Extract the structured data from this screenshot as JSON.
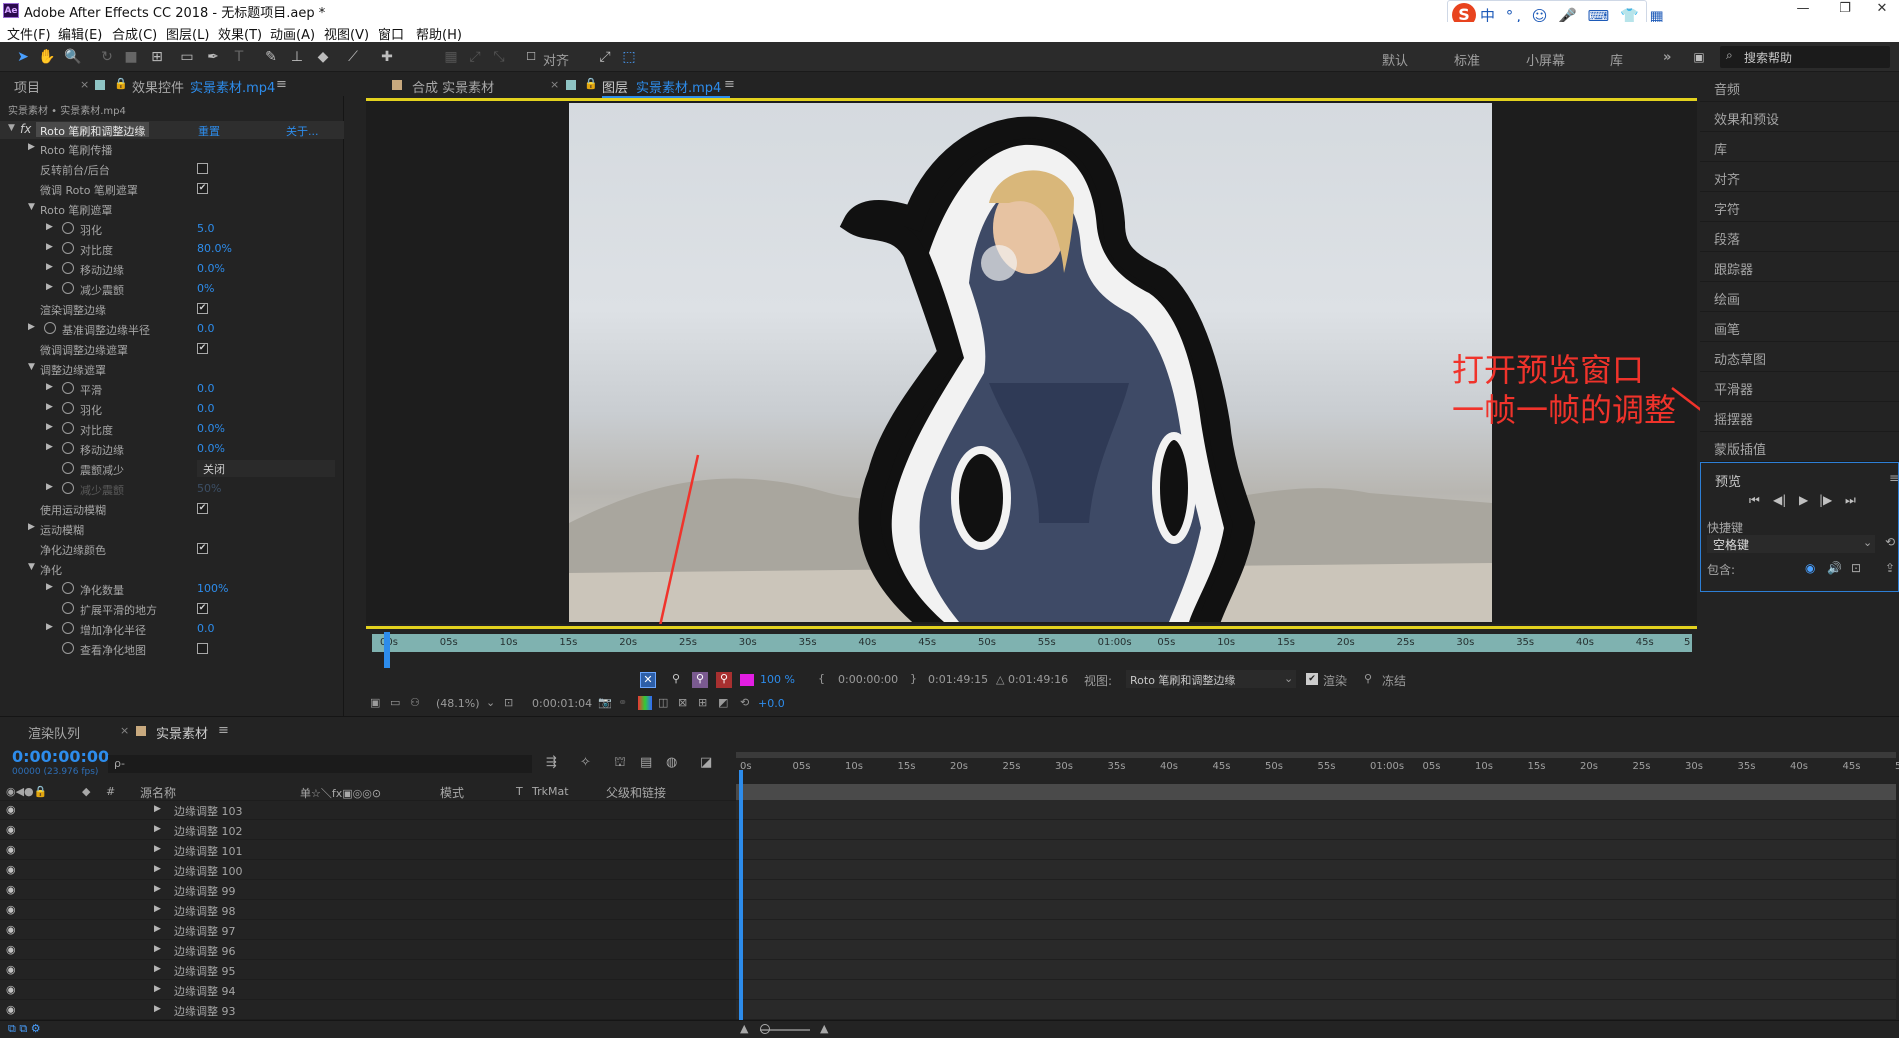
{
  "window": {
    "title": "Adobe After Effects CC 2018 - 无标题项目.aep *",
    "app_icon": "Ae",
    "controls": [
      "—",
      "❐",
      "✕"
    ]
  },
  "menu": [
    "文件(F)",
    "编辑(E)",
    "合成(C)",
    "图层(L)",
    "效果(T)",
    "动画(A)",
    "视图(V)",
    "窗口",
    "帮助(H)"
  ],
  "ime": {
    "logo": "S",
    "text": "中 °, ☺ 🎤 ⌨ 👕 ▦"
  },
  "toolbar": {
    "align_label": "对齐",
    "workspaces": [
      "默认",
      "标准",
      "小屏幕",
      "库"
    ],
    "overflow": "»",
    "search_placeholder": "搜索帮助"
  },
  "left_panel": {
    "tab_project": "项目",
    "tab_effects_prefix": "效果控件",
    "tab_effects_file": "实景素材.mp4",
    "menu_icon": "≡",
    "breadcrumb": "实景素材 • 实景素材.mp4",
    "effect_name": "Roto 笔刷和调整边缘",
    "reset": "重置",
    "about": "关于...",
    "fx": "fx",
    "props": [
      {
        "label": "Roto 笔刷传播",
        "indent": 1,
        "tri": "▶"
      },
      {
        "label": "反转前台/后台",
        "indent": 1,
        "check": ""
      },
      {
        "label": "微调 Roto 笔刷遮罩",
        "indent": 1,
        "check": "✔"
      },
      {
        "label": "Roto 笔刷遮罩",
        "indent": 1,
        "tri": "▼"
      },
      {
        "label": "羽化",
        "indent": 2,
        "tri": "▶",
        "sw": true,
        "value": "5.0"
      },
      {
        "label": "对比度",
        "indent": 2,
        "tri": "▶",
        "sw": true,
        "value": "80.0%"
      },
      {
        "label": "移动边缘",
        "indent": 2,
        "tri": "▶",
        "sw": true,
        "value": "0.0%"
      },
      {
        "label": "减少震颤",
        "indent": 2,
        "tri": "▶",
        "sw": true,
        "value": "0%"
      },
      {
        "label": "渲染调整边缘",
        "indent": 1,
        "check": "✔"
      },
      {
        "label": "基准调整边缘半径",
        "indent": 1,
        "tri": "▶",
        "sw": true,
        "value": "0.0"
      },
      {
        "label": "微调调整边缘遮罩",
        "indent": 1,
        "check": "✔"
      },
      {
        "label": "调整边缘遮罩",
        "indent": 1,
        "tri": "▼"
      },
      {
        "label": "平滑",
        "indent": 2,
        "tri": "▶",
        "sw": true,
        "value": "0.0"
      },
      {
        "label": "羽化",
        "indent": 2,
        "tri": "▶",
        "sw": true,
        "value": "0.0"
      },
      {
        "label": "对比度",
        "indent": 2,
        "tri": "▶",
        "sw": true,
        "value": "0.0%"
      },
      {
        "label": "移动边缘",
        "indent": 2,
        "tri": "▶",
        "sw": true,
        "value": "0.0%"
      },
      {
        "label": "震颤减少",
        "indent": 2,
        "sw": true,
        "select": "关闭"
      },
      {
        "label": "减少震颤",
        "indent": 2,
        "tri": "▶",
        "sw": true,
        "value": "50%",
        "dim": true
      },
      {
        "label": "使用运动模糊",
        "indent": 1,
        "check": "✔"
      },
      {
        "label": "运动模糊",
        "indent": 1,
        "tri": "▶"
      },
      {
        "label": "净化边缘颜色",
        "indent": 1,
        "check": "✔"
      },
      {
        "label": "净化",
        "indent": 1,
        "tri": "▼"
      },
      {
        "label": "净化数量",
        "indent": 2,
        "tri": "▶",
        "sw": true,
        "value": "100%"
      },
      {
        "label": "扩展平滑的地方",
        "indent": 2,
        "sw": true,
        "check": "✔"
      },
      {
        "label": "增加净化半径",
        "indent": 2,
        "tri": "▶",
        "sw": true,
        "value": "0.0"
      },
      {
        "label": "查看净化地图",
        "indent": 2,
        "sw": true,
        "check": ""
      }
    ]
  },
  "comp_panel": {
    "tab_comp": "合成 实景素材",
    "tab_layer_prefix": "图层",
    "tab_layer_file": "实景素材.mp4",
    "ruler": [
      "00s",
      "05s",
      "10s",
      "15s",
      "20s",
      "25s",
      "30s",
      "35s",
      "40s",
      "45s",
      "50s",
      "55s",
      "01:00s",
      "05s",
      "10s",
      "15s",
      "20s",
      "25s",
      "30s",
      "35s",
      "40s",
      "45s"
    ],
    "ruler_end": "5",
    "opacity": "100 %",
    "in_time": "0:00:00:00",
    "out_time": "0:01:49:15",
    "duration": "△ 0:01:49:16",
    "view_label": "视图:",
    "view_value": "Roto 笔刷和调整边缘",
    "render_label": "渲染",
    "freeze_label": "冻结",
    "zoom": "(48.1%)",
    "timecode": "0:00:01:04",
    "exposure": "+0.0"
  },
  "annotation": {
    "line1": "打开预览窗口",
    "line2": "一帧一帧的调整",
    "color": "#f0332b"
  },
  "right_panel": {
    "items": [
      "音频",
      "效果和预设",
      "库",
      "对齐",
      "字符",
      "段落",
      "跟踪器",
      "绘画",
      "画笔",
      "动态草图",
      "平滑器",
      "摇摆器",
      "蒙版插值"
    ],
    "preview": {
      "title": "预览",
      "menu": "≡",
      "shortcut_label": "快捷键",
      "shortcut_value": "空格键",
      "include_label": "包含:"
    }
  },
  "timeline": {
    "tab_render": "渲染队列",
    "tab_comp": "实景素材",
    "timecode": "0:00:00:00",
    "timecode_sub": "00000 (23.976 fps)",
    "search_placeholder": "ρ-",
    "col_num": "#",
    "col_source": "源名称",
    "col_switches": "单☆＼fx▣◎◎⊙",
    "col_mode": "模式",
    "col_t": "T",
    "col_trkmat": "TrkMat",
    "col_parent": "父级和链接",
    "ruler": [
      "0s",
      "05s",
      "10s",
      "15s",
      "20s",
      "25s",
      "30s",
      "35s",
      "40s",
      "45s",
      "50s",
      "55s",
      "01:00s",
      "05s",
      "10s",
      "15s",
      "20s",
      "25s",
      "30s",
      "35s",
      "40s",
      "45s",
      "50"
    ],
    "rows": [
      "边缘调整 103",
      "边缘调整 102",
      "边缘调整 101",
      "边缘调整 100",
      "边缘调整 99",
      "边缘调整 98",
      "边缘调整 97",
      "边缘调整 96",
      "边缘调整 95",
      "边缘调整 94",
      "边缘调整 93"
    ]
  }
}
